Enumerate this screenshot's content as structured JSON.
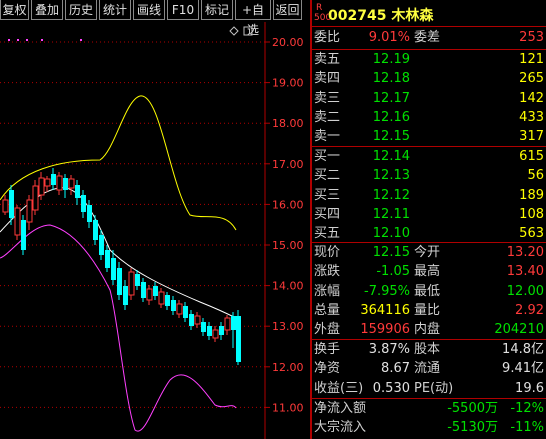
{
  "toolbar": {
    "buttons": [
      "复权",
      "叠加",
      "历史",
      "统计",
      "画线",
      "F10",
      "标记",
      "+自选",
      "返回"
    ]
  },
  "chart": {
    "y_ticks": [
      "20.00",
      "19.00",
      "18.00",
      "17.00",
      "16.00",
      "15.00",
      "14.00",
      "13.00",
      "12.00",
      "11.00"
    ],
    "colors": {
      "up": "#ff3a3a",
      "down": "#00ffff",
      "ma_white": "#ffffff",
      "band_yellow": "#ffff00",
      "band_magenta": "#ff40ff",
      "axis": "#b00000"
    }
  },
  "stock": {
    "badge_top": "R",
    "badge_bottom": "500",
    "code_name": "002745 木林森"
  },
  "weibi": {
    "l1": "委比",
    "v1": "9.01%",
    "l2": "委差",
    "v2": "253"
  },
  "sells": [
    {
      "label": "卖五",
      "price": "12.19",
      "vol": "121"
    },
    {
      "label": "卖四",
      "price": "12.18",
      "vol": "265"
    },
    {
      "label": "卖三",
      "price": "12.17",
      "vol": "142"
    },
    {
      "label": "卖二",
      "price": "12.16",
      "vol": "433"
    },
    {
      "label": "卖一",
      "price": "12.15",
      "vol": "317"
    }
  ],
  "buys": [
    {
      "label": "买一",
      "price": "12.14",
      "vol": "615"
    },
    {
      "label": "买二",
      "price": "12.13",
      "vol": "56"
    },
    {
      "label": "买三",
      "price": "12.12",
      "vol": "189"
    },
    {
      "label": "买四",
      "price": "12.11",
      "vol": "108"
    },
    {
      "label": "买五",
      "price": "12.10",
      "vol": "563"
    }
  ],
  "quote": [
    {
      "l1": "现价",
      "v1": "12.15",
      "l2": "今开",
      "v2": "13.20"
    },
    {
      "l1": "涨跌",
      "v1": "-1.05",
      "l2": "最高",
      "v2": "13.40"
    },
    {
      "l1": "涨幅",
      "v1": "-7.95%",
      "l2": "最低",
      "v2": "12.00"
    },
    {
      "l1": "总量",
      "v1": "364116",
      "l2": "量比",
      "v2": "2.92"
    },
    {
      "l1": "外盘",
      "v1": "159906",
      "l2": "内盘",
      "v2": "204210"
    }
  ],
  "fund": [
    {
      "l1": "换手",
      "v1": "3.87%",
      "l2": "股本",
      "v2": "14.8亿"
    },
    {
      "l1": "净资",
      "v1": "8.67",
      "l2": "流通",
      "v2": "9.41亿"
    },
    {
      "l1": "收益(三)",
      "v1": "0.530",
      "l2": "PE(动)",
      "v2": "19.6"
    }
  ],
  "flow": [
    {
      "label": "净流入额",
      "amount": "-5500万",
      "pct": "-12%"
    },
    {
      "label": "大宗流入",
      "amount": "-5130万",
      "pct": "-11%"
    }
  ]
}
